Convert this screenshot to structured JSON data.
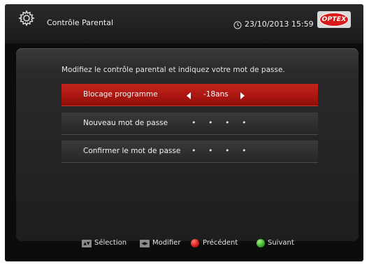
{
  "header": {
    "title": "Contrôle Parental",
    "datetime": "23/10/2013 15:59",
    "logo_text": "OPTEX",
    "icons": [
      "gear-icon",
      "clock-icon"
    ]
  },
  "main": {
    "instructions": "Modifiez le contrôle parental et indiquez votre mot de passe.",
    "rows": [
      {
        "label": "Blocage programme",
        "value": "-18ans",
        "selected": true
      },
      {
        "label": "Nouveau mot de passe",
        "value": "• • • •",
        "selected": false
      },
      {
        "label": "Confirmer le mot de passe",
        "value": "• • • •",
        "selected": false
      }
    ]
  },
  "footer": {
    "items": [
      {
        "key_glyph": "▲▼",
        "label": "Sélection"
      },
      {
        "key_glyph": "◀▶",
        "label": "Modifier"
      },
      {
        "key_color": "#d91f1f",
        "label": "Précédent"
      },
      {
        "key_color": "#3cb52a",
        "label": "Suivant"
      }
    ]
  },
  "colors": {
    "selected_row": "#b01a12",
    "background": "#0c0c0c",
    "accent_red": "#d91f1f",
    "accent_green": "#3cb52a"
  }
}
